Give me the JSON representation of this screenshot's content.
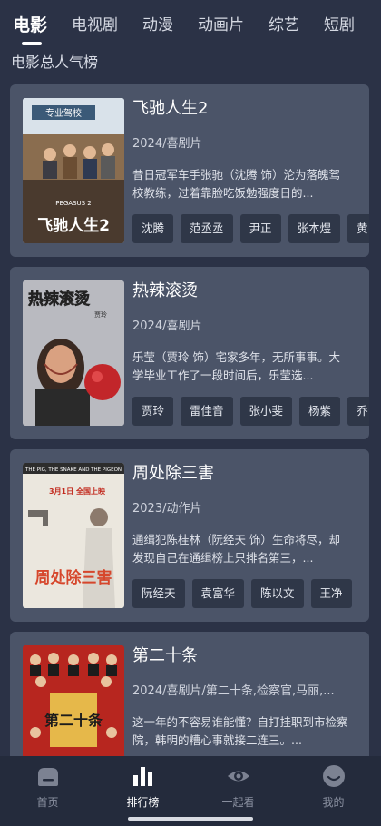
{
  "tabs": [
    {
      "label": "电影",
      "active": true
    },
    {
      "label": "电视剧",
      "active": false
    },
    {
      "label": "动漫",
      "active": false
    },
    {
      "label": "动画片",
      "active": false
    },
    {
      "label": "综艺",
      "active": false
    },
    {
      "label": "短剧",
      "active": false
    }
  ],
  "section_title": "电影总人气榜",
  "movies": [
    {
      "title": "飞驰人生2",
      "meta": "2024/喜剧片",
      "description": "昔日冠军车手张驰（沈腾 饰）沦为落魄驾校教练，过着靠脸吃饭勉强度日的...",
      "cast": [
        "沈腾",
        "范丞丞",
        "尹正",
        "张本煜",
        "黄"
      ],
      "poster": {
        "header_text": "专业驾校",
        "footer_text": "飞驰人生2",
        "sub_text": "PEGASUS 2",
        "colors": [
          "#c9d4df",
          "#7a5a3c",
          "#3a2a20"
        ]
      }
    },
    {
      "title": "热辣滚烫",
      "meta": "2024/喜剧片",
      "description": "乐莹（贾玲 饰）宅家多年，无所事事。大学毕业工作了一段时间后，乐莹选...",
      "cast": [
        "贾玲",
        "雷佳音",
        "张小斐",
        "杨紫",
        "乔"
      ],
      "poster": {
        "header_text": "热辣滚烫",
        "footer_text": "",
        "sub_text": "贾玲",
        "colors": [
          "#b7b8bd",
          "#d9a181",
          "#c2262a"
        ]
      }
    },
    {
      "title": "周处除三害",
      "meta": "2023/动作片",
      "description": "通缉犯陈桂林（阮经天 饰）生命将尽，却发现自己在通缉榜上只排名第三，...",
      "cast": [
        "阮经天",
        "袁富华",
        "陈以文",
        "王净"
      ],
      "poster": {
        "header_text": "THE PIG, THE SNAKE AND THE PIGEON",
        "footer_text": "周处除三害",
        "sub_text": "3月1日 全国上映",
        "colors": [
          "#e9e5dc",
          "#6f6b66",
          "#d6462b"
        ]
      }
    },
    {
      "title": "第二十条",
      "meta": "2024/喜剧片/第二十条,检察官,马丽,...",
      "description": "这一年的不容易谁能懂？自打挂职到市检察院，韩明的糟心事就接二连三。...",
      "cast": [],
      "poster": {
        "header_text": "",
        "footer_text": "第二十条",
        "sub_text": "",
        "colors": [
          "#b7261f",
          "#e6b84a",
          "#1c1c1c"
        ]
      }
    }
  ],
  "bottom_nav": [
    {
      "label": "首页",
      "icon": "home-icon",
      "active": false
    },
    {
      "label": "排行榜",
      "icon": "bar-chart-icon",
      "active": true
    },
    {
      "label": "一起看",
      "icon": "eye-icon",
      "active": false
    },
    {
      "label": "我的",
      "icon": "face-icon",
      "active": false
    }
  ],
  "colors": {
    "background": "#2b3246",
    "card": "#4b5468",
    "chip": "#2f3748",
    "nav": "#242b3c"
  }
}
